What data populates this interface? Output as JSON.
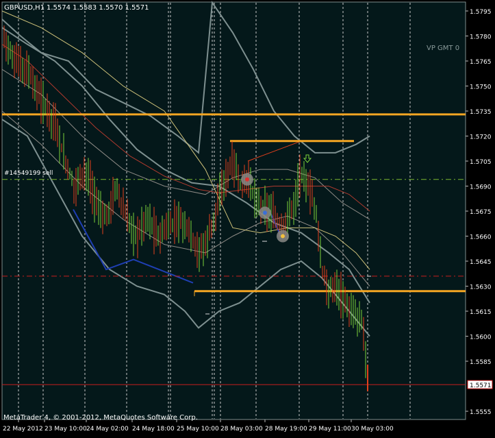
{
  "header": {
    "symbol_label": "GBPUSD,H1",
    "ohlc_label": "1.5574 1.5583 1.5570 1.5571"
  },
  "watermark": "VP GMT 0",
  "copyright": "MetaTrader 4, © 2001-2012, MetaQuotes Software Corp.",
  "order_label": "#14549199 sell",
  "colors": {
    "background": "#000000",
    "chart_area": "#04181a",
    "grid": "#c8c8c8",
    "bull_candle": "#7cd23a",
    "bear_candle": "#e3401c",
    "level_line": "#f5a623",
    "order_line": "#7cb82f",
    "dash_line": "#c81e1e",
    "price_line": "#c81e1e",
    "band_outer": "#7e9090",
    "band_mid": "#8d8a85",
    "ma_red": "#b03a2e",
    "ma_yellow": "#cfc27a",
    "trend_blue": "#1f3fb4",
    "text": "#ffffff"
  },
  "chart_data": {
    "type": "candlestick",
    "symbol": "GBPUSD",
    "timeframe": "H1",
    "ylim": [
      1.5548,
      1.58
    ],
    "y_ticks": [
      "1.5795",
      "1.5780",
      "1.5765",
      "1.5750",
      "1.5735",
      "1.5720",
      "1.5705",
      "1.5690",
      "1.5675",
      "1.5660",
      "1.5645",
      "1.5630",
      "1.5615",
      "1.5600",
      "1.5585",
      "1.5555"
    ],
    "x_ticks": [
      "22 May 2012",
      "23 May 10:00",
      "24 May 02:00",
      "24 May 18:00",
      "25 May 10:00",
      "28 May 03:00",
      "28 May 19:00",
      "29 May 11:00",
      "30 May 03:00"
    ],
    "current_price": "1.5571",
    "current_price_value": 1.5571,
    "order_price_value": 1.5694,
    "horizontal_levels": [
      1.5733,
      1.5717,
      1.5627
    ],
    "dashed_level": 1.5636,
    "last_ohlc": {
      "open": 1.5574,
      "high": 1.5583,
      "low": 1.557,
      "close": 1.5571
    }
  }
}
